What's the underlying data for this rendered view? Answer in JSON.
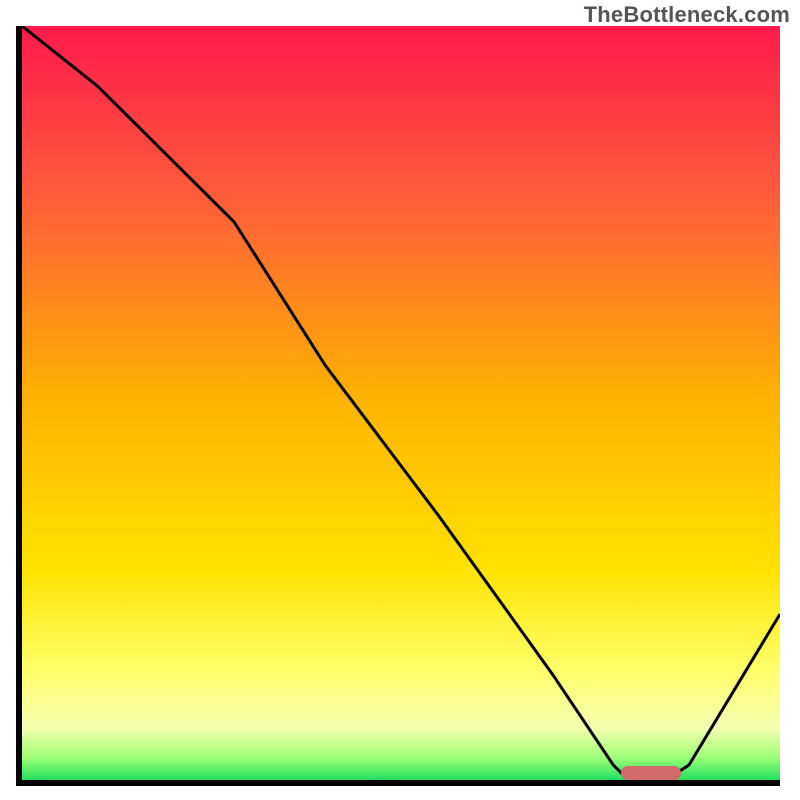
{
  "watermark": "TheBottleneck.com",
  "chart_data": {
    "type": "line",
    "title": "",
    "xlabel": "",
    "ylabel": "",
    "xlim": [
      0,
      100
    ],
    "ylim": [
      0,
      100
    ],
    "grid": false,
    "legend": false,
    "series": [
      {
        "name": "bottleneck-curve",
        "x": [
          0,
          10,
          22,
          28,
          40,
          55,
          70,
          78,
          80,
          85,
          88,
          100
        ],
        "values": [
          100,
          92,
          80,
          74,
          55,
          35,
          14,
          2,
          0,
          0,
          2,
          22
        ]
      }
    ],
    "annotations": [
      {
        "name": "optimal-range-marker",
        "x_start": 79,
        "x_end": 87,
        "y": 0,
        "color": "#d46a6a"
      }
    ],
    "background_gradient_stops": [
      {
        "pct": 0,
        "color": "#ff1a4b"
      },
      {
        "pct": 22,
        "color": "#ff5a3c"
      },
      {
        "pct": 50,
        "color": "#ffb400"
      },
      {
        "pct": 72,
        "color": "#ffe200"
      },
      {
        "pct": 85,
        "color": "#ffff66"
      },
      {
        "pct": 93,
        "color": "#f6ffb0"
      },
      {
        "pct": 97,
        "color": "#9fff78"
      },
      {
        "pct": 100,
        "color": "#20e060"
      }
    ]
  }
}
